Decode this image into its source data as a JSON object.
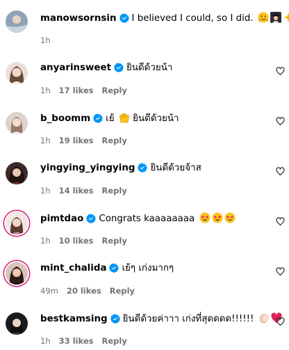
{
  "post": {
    "username": "manowsornsin",
    "caption": "I believed I could, so I did.",
    "caption_emojis": [
      "hugging-face-emoji",
      "graduation-person-emoji",
      "sparkles-emoji"
    ],
    "time": "1h"
  },
  "comments": [
    {
      "username": "anyarinsweet",
      "text": "ยินดีด้วยน้า",
      "time": "1h",
      "likes": "17 likes",
      "reply": "Reply"
    },
    {
      "username": "b_boomm",
      "text_before": "เย้",
      "text": "ยินดีด้วยน้า",
      "time": "1h",
      "likes": "19 likes",
      "reply": "Reply"
    },
    {
      "username": "yingying_yingying",
      "text": "ยินดีด้วยจ้าส",
      "time": "1h",
      "likes": "14 likes",
      "reply": "Reply"
    },
    {
      "username": "pimtdao",
      "text": "Congrats kaaaaaaaa",
      "time": "1h",
      "likes": "10 likes",
      "reply": "Reply"
    },
    {
      "username": "mint_chalida",
      "text": "เย้ๆ เก่งมากๆ",
      "time": "49m",
      "likes": "20 likes",
      "reply": "Reply"
    },
    {
      "username": "bestkamsing",
      "text": "ยินดีด้วยค่าาา เก่งที่สุดดดด!!!!!!",
      "time": "1h",
      "likes": "33 likes",
      "reply": "Reply"
    }
  ],
  "colors": {
    "verified": "#0095f6",
    "meta": "#737373",
    "story_ring": "#d81b7a",
    "heart_emoji": "#e0245e"
  }
}
